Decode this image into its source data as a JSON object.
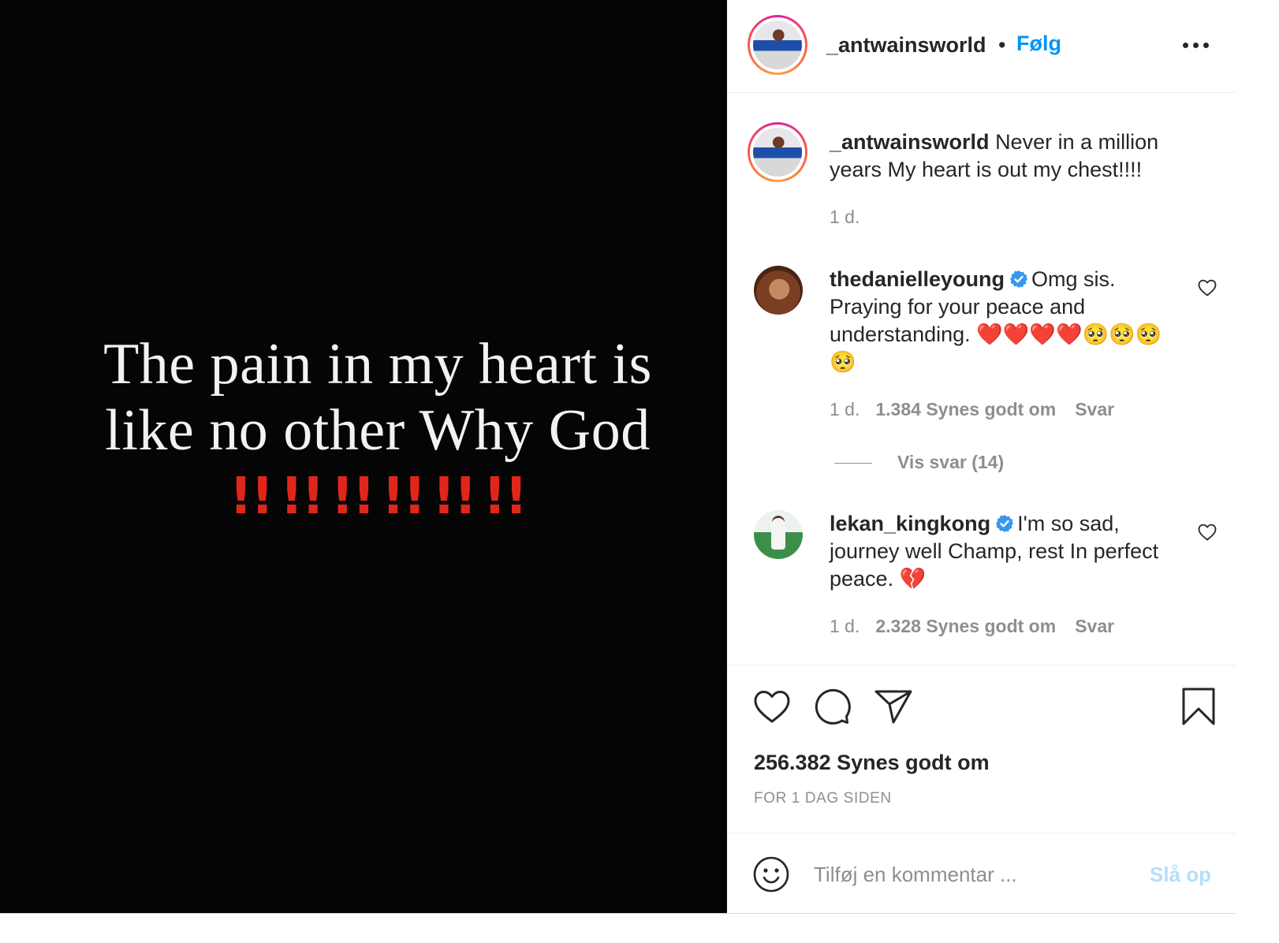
{
  "media": {
    "line1": "The pain in my heart is",
    "line2": "like no other Why God",
    "bangs": [
      "!!",
      "!!",
      "!!",
      "!!",
      "!!",
      "!!"
    ]
  },
  "header": {
    "username": "_antwainsworld",
    "dot": "•",
    "follow_label": "Følg"
  },
  "caption": {
    "username": "_antwainsworld",
    "text": "Never in a million years My heart is out my chest!!!!",
    "age": "1 d."
  },
  "comments": [
    {
      "username": "thedanielleyoung",
      "verified": true,
      "text": "Omg sis. Praying for your peace and understanding. ❤️❤️❤️❤️🥺🥺🥺🥺",
      "age": "1 d.",
      "likes": "1.384 Synes godt om",
      "reply": "Svar"
    },
    {
      "username": "lekan_kingkong",
      "verified": true,
      "text": "I'm so sad, journey well Champ, rest In perfect peace. 💔",
      "age": "1 d.",
      "likes": "2.328 Synes godt om",
      "reply": "Svar"
    }
  ],
  "view_replies": "Vis svar (14)",
  "actions": {
    "likes_total": "256.382 Synes godt om",
    "timestamp": "FOR 1 DAG SIDEN"
  },
  "comment_box": {
    "placeholder": "Tilføj en kommentar ...",
    "post_label": "Slå op"
  },
  "colors": {
    "link_blue": "#0095f6",
    "post_disabled": "#b2dffc",
    "exclamation_red": "#e0261b",
    "verified_blue": "#3897f0",
    "muted": "#8e8e8e"
  }
}
